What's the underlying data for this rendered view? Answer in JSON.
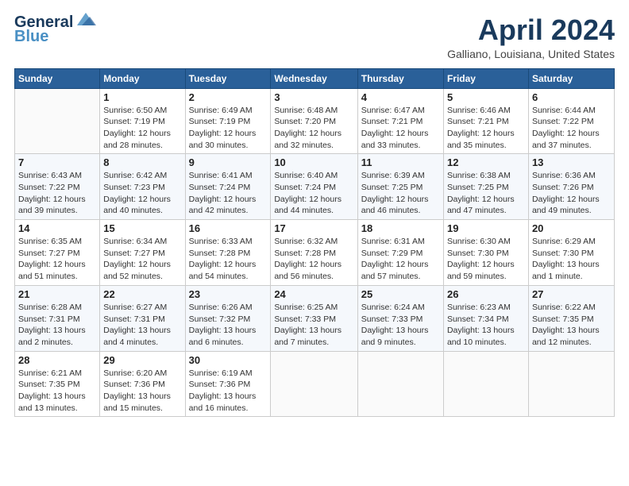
{
  "header": {
    "logo_line1": "General",
    "logo_line2": "Blue",
    "month": "April 2024",
    "location": "Galliano, Louisiana, United States"
  },
  "days_of_week": [
    "Sunday",
    "Monday",
    "Tuesday",
    "Wednesday",
    "Thursday",
    "Friday",
    "Saturday"
  ],
  "weeks": [
    [
      {
        "day": "",
        "info": ""
      },
      {
        "day": "1",
        "info": "Sunrise: 6:50 AM\nSunset: 7:19 PM\nDaylight: 12 hours\nand 28 minutes."
      },
      {
        "day": "2",
        "info": "Sunrise: 6:49 AM\nSunset: 7:19 PM\nDaylight: 12 hours\nand 30 minutes."
      },
      {
        "day": "3",
        "info": "Sunrise: 6:48 AM\nSunset: 7:20 PM\nDaylight: 12 hours\nand 32 minutes."
      },
      {
        "day": "4",
        "info": "Sunrise: 6:47 AM\nSunset: 7:21 PM\nDaylight: 12 hours\nand 33 minutes."
      },
      {
        "day": "5",
        "info": "Sunrise: 6:46 AM\nSunset: 7:21 PM\nDaylight: 12 hours\nand 35 minutes."
      },
      {
        "day": "6",
        "info": "Sunrise: 6:44 AM\nSunset: 7:22 PM\nDaylight: 12 hours\nand 37 minutes."
      }
    ],
    [
      {
        "day": "7",
        "info": "Sunrise: 6:43 AM\nSunset: 7:22 PM\nDaylight: 12 hours\nand 39 minutes."
      },
      {
        "day": "8",
        "info": "Sunrise: 6:42 AM\nSunset: 7:23 PM\nDaylight: 12 hours\nand 40 minutes."
      },
      {
        "day": "9",
        "info": "Sunrise: 6:41 AM\nSunset: 7:24 PM\nDaylight: 12 hours\nand 42 minutes."
      },
      {
        "day": "10",
        "info": "Sunrise: 6:40 AM\nSunset: 7:24 PM\nDaylight: 12 hours\nand 44 minutes."
      },
      {
        "day": "11",
        "info": "Sunrise: 6:39 AM\nSunset: 7:25 PM\nDaylight: 12 hours\nand 46 minutes."
      },
      {
        "day": "12",
        "info": "Sunrise: 6:38 AM\nSunset: 7:25 PM\nDaylight: 12 hours\nand 47 minutes."
      },
      {
        "day": "13",
        "info": "Sunrise: 6:36 AM\nSunset: 7:26 PM\nDaylight: 12 hours\nand 49 minutes."
      }
    ],
    [
      {
        "day": "14",
        "info": "Sunrise: 6:35 AM\nSunset: 7:27 PM\nDaylight: 12 hours\nand 51 minutes."
      },
      {
        "day": "15",
        "info": "Sunrise: 6:34 AM\nSunset: 7:27 PM\nDaylight: 12 hours\nand 52 minutes."
      },
      {
        "day": "16",
        "info": "Sunrise: 6:33 AM\nSunset: 7:28 PM\nDaylight: 12 hours\nand 54 minutes."
      },
      {
        "day": "17",
        "info": "Sunrise: 6:32 AM\nSunset: 7:28 PM\nDaylight: 12 hours\nand 56 minutes."
      },
      {
        "day": "18",
        "info": "Sunrise: 6:31 AM\nSunset: 7:29 PM\nDaylight: 12 hours\nand 57 minutes."
      },
      {
        "day": "19",
        "info": "Sunrise: 6:30 AM\nSunset: 7:30 PM\nDaylight: 12 hours\nand 59 minutes."
      },
      {
        "day": "20",
        "info": "Sunrise: 6:29 AM\nSunset: 7:30 PM\nDaylight: 13 hours\nand 1 minute."
      }
    ],
    [
      {
        "day": "21",
        "info": "Sunrise: 6:28 AM\nSunset: 7:31 PM\nDaylight: 13 hours\nand 2 minutes."
      },
      {
        "day": "22",
        "info": "Sunrise: 6:27 AM\nSunset: 7:31 PM\nDaylight: 13 hours\nand 4 minutes."
      },
      {
        "day": "23",
        "info": "Sunrise: 6:26 AM\nSunset: 7:32 PM\nDaylight: 13 hours\nand 6 minutes."
      },
      {
        "day": "24",
        "info": "Sunrise: 6:25 AM\nSunset: 7:33 PM\nDaylight: 13 hours\nand 7 minutes."
      },
      {
        "day": "25",
        "info": "Sunrise: 6:24 AM\nSunset: 7:33 PM\nDaylight: 13 hours\nand 9 minutes."
      },
      {
        "day": "26",
        "info": "Sunrise: 6:23 AM\nSunset: 7:34 PM\nDaylight: 13 hours\nand 10 minutes."
      },
      {
        "day": "27",
        "info": "Sunrise: 6:22 AM\nSunset: 7:35 PM\nDaylight: 13 hours\nand 12 minutes."
      }
    ],
    [
      {
        "day": "28",
        "info": "Sunrise: 6:21 AM\nSunset: 7:35 PM\nDaylight: 13 hours\nand 13 minutes."
      },
      {
        "day": "29",
        "info": "Sunrise: 6:20 AM\nSunset: 7:36 PM\nDaylight: 13 hours\nand 15 minutes."
      },
      {
        "day": "30",
        "info": "Sunrise: 6:19 AM\nSunset: 7:36 PM\nDaylight: 13 hours\nand 16 minutes."
      },
      {
        "day": "",
        "info": ""
      },
      {
        "day": "",
        "info": ""
      },
      {
        "day": "",
        "info": ""
      },
      {
        "day": "",
        "info": ""
      }
    ]
  ]
}
